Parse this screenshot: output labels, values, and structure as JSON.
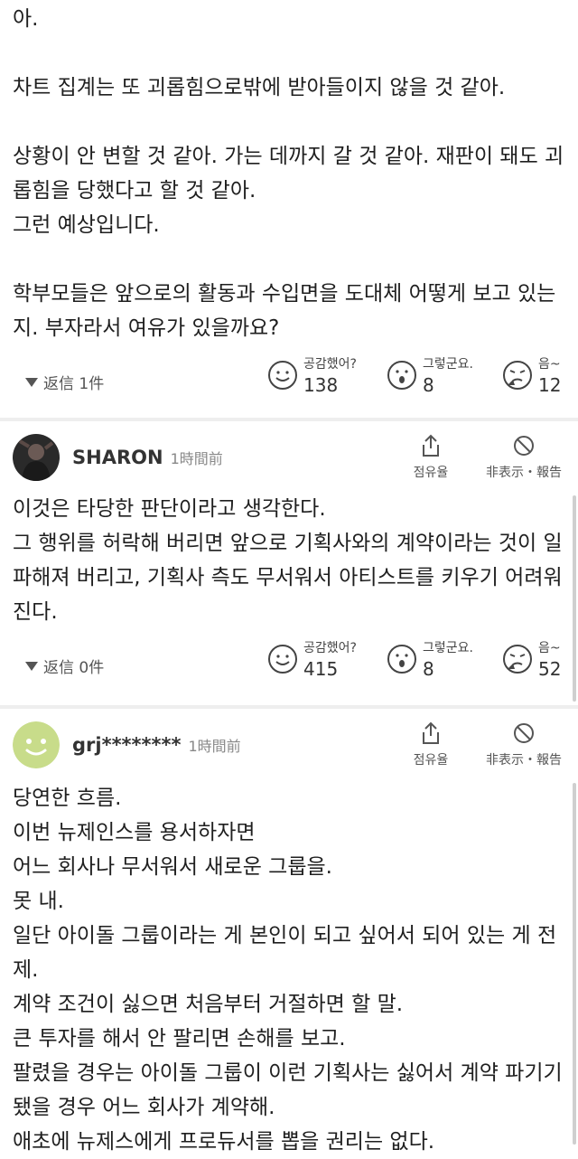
{
  "top_post": {
    "lines": [
      "아.",
      "",
      "차트 집계는 또 괴롭힘으로밖에 받아들이지 않을 것 같아.",
      "",
      "상황이 안 변할 것 같아. 가는 데까지 갈 것 같아. 재판이 돼도 괴",
      "롭힘을 당했다고 할 것 같아.",
      "그런 예상입니다.",
      "",
      "학부모들은 앞으로의 활동과 수입면을 도대체 어떻게 보고 있는",
      "지. 부자라서 여유가 있을까요?"
    ],
    "replies": "返信 1件",
    "reactions": [
      {
        "label": "공감했어?",
        "count": "138",
        "icon": "smile-face-icon"
      },
      {
        "label": "그렇군요.",
        "count": "8",
        "icon": "surprised-face-icon"
      },
      {
        "label": "음~",
        "count": "12",
        "icon": "thinking-face-icon"
      }
    ]
  },
  "comments": [
    {
      "username": "SHARON",
      "time": "1時間前",
      "share_label": "점유율",
      "hide_label": "非表示・報告",
      "avatar": "photo-avatar",
      "lines": [
        "이것은 타당한 판단이라고 생각한다.",
        "그 행위를 허락해 버리면 앞으로 기획사와의 계약이라는 것이 일",
        "파해져 버리고, 기획사 측도 무서워서 아티스트를 키우기 어려워",
        "진다."
      ],
      "replies": "返信 0件",
      "reactions": [
        {
          "label": "공감했어?",
          "count": "415",
          "icon": "smile-face-icon"
        },
        {
          "label": "그렇군요.",
          "count": "8",
          "icon": "surprised-face-icon"
        },
        {
          "label": "음~",
          "count": "52",
          "icon": "thinking-face-icon"
        }
      ]
    },
    {
      "username": "grj********",
      "time": "1時間前",
      "share_label": "점유율",
      "hide_label": "非表示・報告",
      "avatar": "smiley-avatar",
      "lines": [
        "당연한 흐름.",
        "이번 뉴제인스를 용서하자면",
        "어느 회사나 무서워서 새로운 그룹을.",
        "못 내.",
        "일단 아이돌 그룹이라는 게 본인이 되고 싶어서 되어 있는 게 전",
        "제.",
        "계약 조건이 싫으면 처음부터 거절하면 할 말.",
        "큰 투자를 해서 안 팔리면 손해를 보고.",
        "팔렸을 경우는 아이돌 그룹이 이런 기획사는 싫어서 계약 파기기",
        "됐을 경우 어느 회사가 계약해.",
        "애초에 뉴제스에게 프로듀서를 뽑을 권리는 없다."
      ]
    }
  ],
  "colors": {
    "accent_avatar": "#c8dc8a",
    "separator": "#eeeeee",
    "text": "#1f1f1f"
  }
}
